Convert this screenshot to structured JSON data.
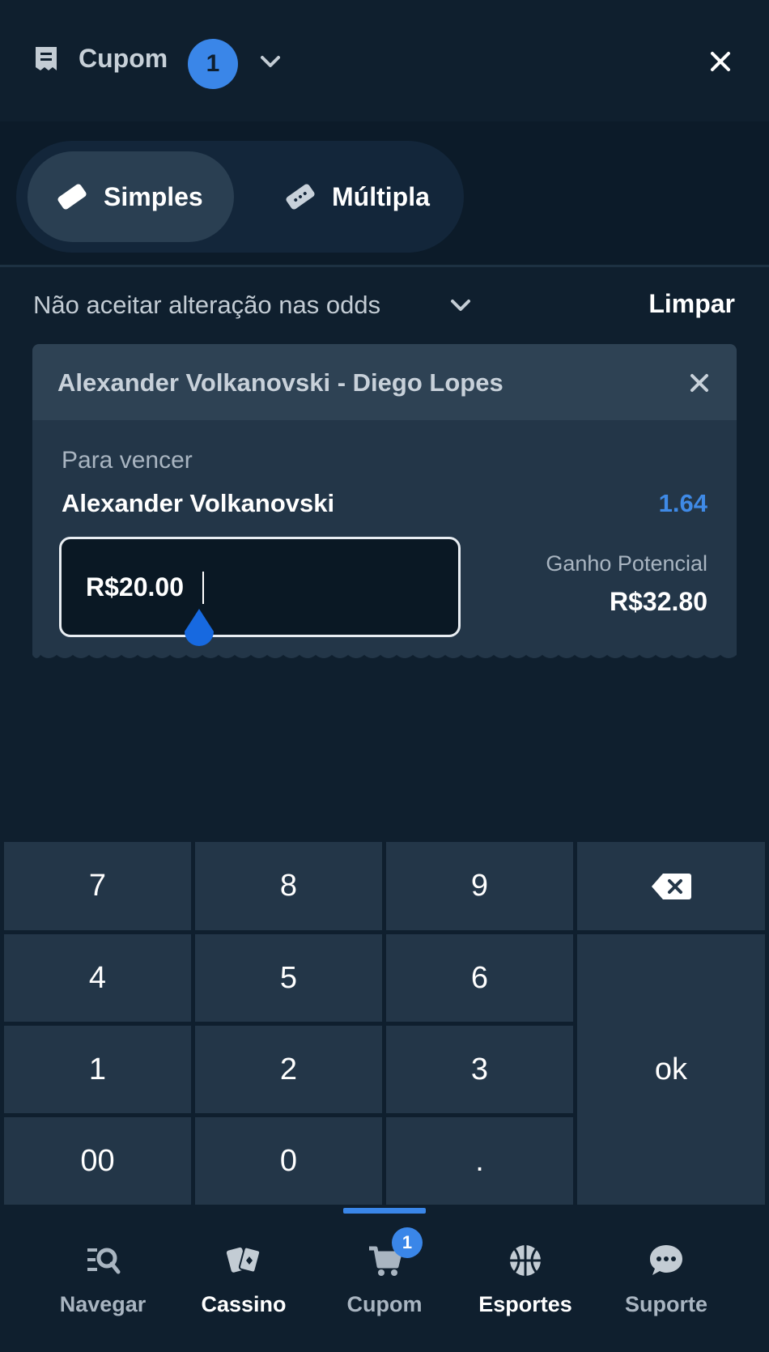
{
  "header": {
    "title": "Cupom",
    "count": "1",
    "icons": {
      "receipt": "receipt-icon",
      "chevron": "chevron-down-icon",
      "close": "close-icon"
    }
  },
  "tabs": [
    {
      "label": "Simples",
      "active": true,
      "icon": "ticket-icon"
    },
    {
      "label": "Múltipla",
      "active": false,
      "icon": "tickets-icon"
    }
  ],
  "odds_setting": {
    "label": "Não aceitar alteração nas odds",
    "clear_label": "Limpar"
  },
  "bet": {
    "event": "Alexander Volkanovski - Diego Lopes",
    "market": "Para vencer",
    "selection": "Alexander Volkanovski",
    "odd": "1.64",
    "stake": "R$20.00",
    "potential_label": "Ganho Potencial",
    "potential_value": "R$32.80"
  },
  "keypad": {
    "keys": [
      "7",
      "8",
      "9",
      "4",
      "5",
      "6",
      "1",
      "2",
      "3",
      "00",
      "0",
      "."
    ],
    "ok": "ok",
    "backspace_icon": "backspace-icon"
  },
  "nav": {
    "items": [
      {
        "label": "Navegar",
        "icon": "browse-icon"
      },
      {
        "label": "Cassino",
        "icon": "cards-icon"
      },
      {
        "label": "Cupom",
        "icon": "cart-icon",
        "badge": "1",
        "active": true
      },
      {
        "label": "Esportes",
        "icon": "basketball-icon"
      },
      {
        "label": "Suporte",
        "icon": "chat-icon"
      }
    ]
  },
  "colors": {
    "background": "#0f1f2e",
    "accent": "#3a86e8",
    "card": "#233648",
    "key": "#233648",
    "muted_text": "#a9b5c1"
  }
}
